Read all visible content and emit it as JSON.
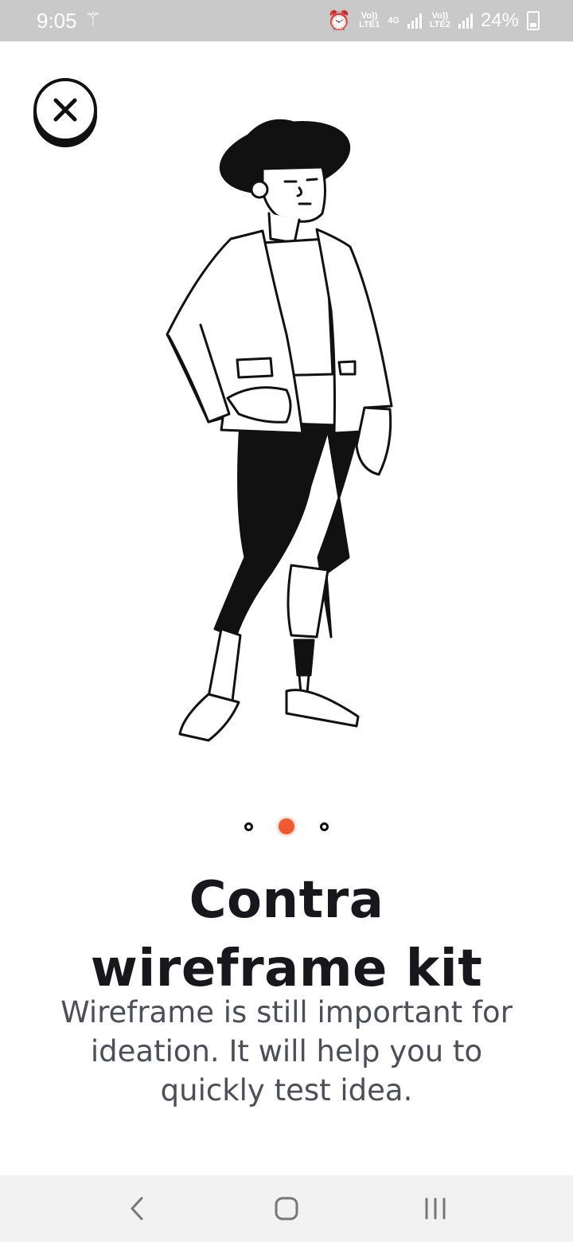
{
  "status_bar": {
    "time": "9:05",
    "signal1_top": "Vo))",
    "signal1_bottom": "LTE1",
    "network": "4G",
    "signal2_top": "Vo))",
    "signal2_bottom": "LTE2",
    "battery": "24%"
  },
  "pager": {
    "total": 3,
    "active_index": 1
  },
  "onboarding": {
    "title_line1": "Contra",
    "title_line2": "wireframe kit",
    "description_line1": "Wireframe is still important for",
    "description_line2": "ideation. It will help you to",
    "description_line3": "quickly test idea."
  },
  "colors": {
    "accent": "#f05a33",
    "ink": "#17171c",
    "body_text": "#4c4e59",
    "status_bar_bg": "#c9c9c9",
    "nav_bar_bg": "#f2f2f2"
  },
  "icons": {
    "close": "close-icon",
    "back": "back-icon",
    "home": "home-icon",
    "recents": "recents-icon"
  }
}
